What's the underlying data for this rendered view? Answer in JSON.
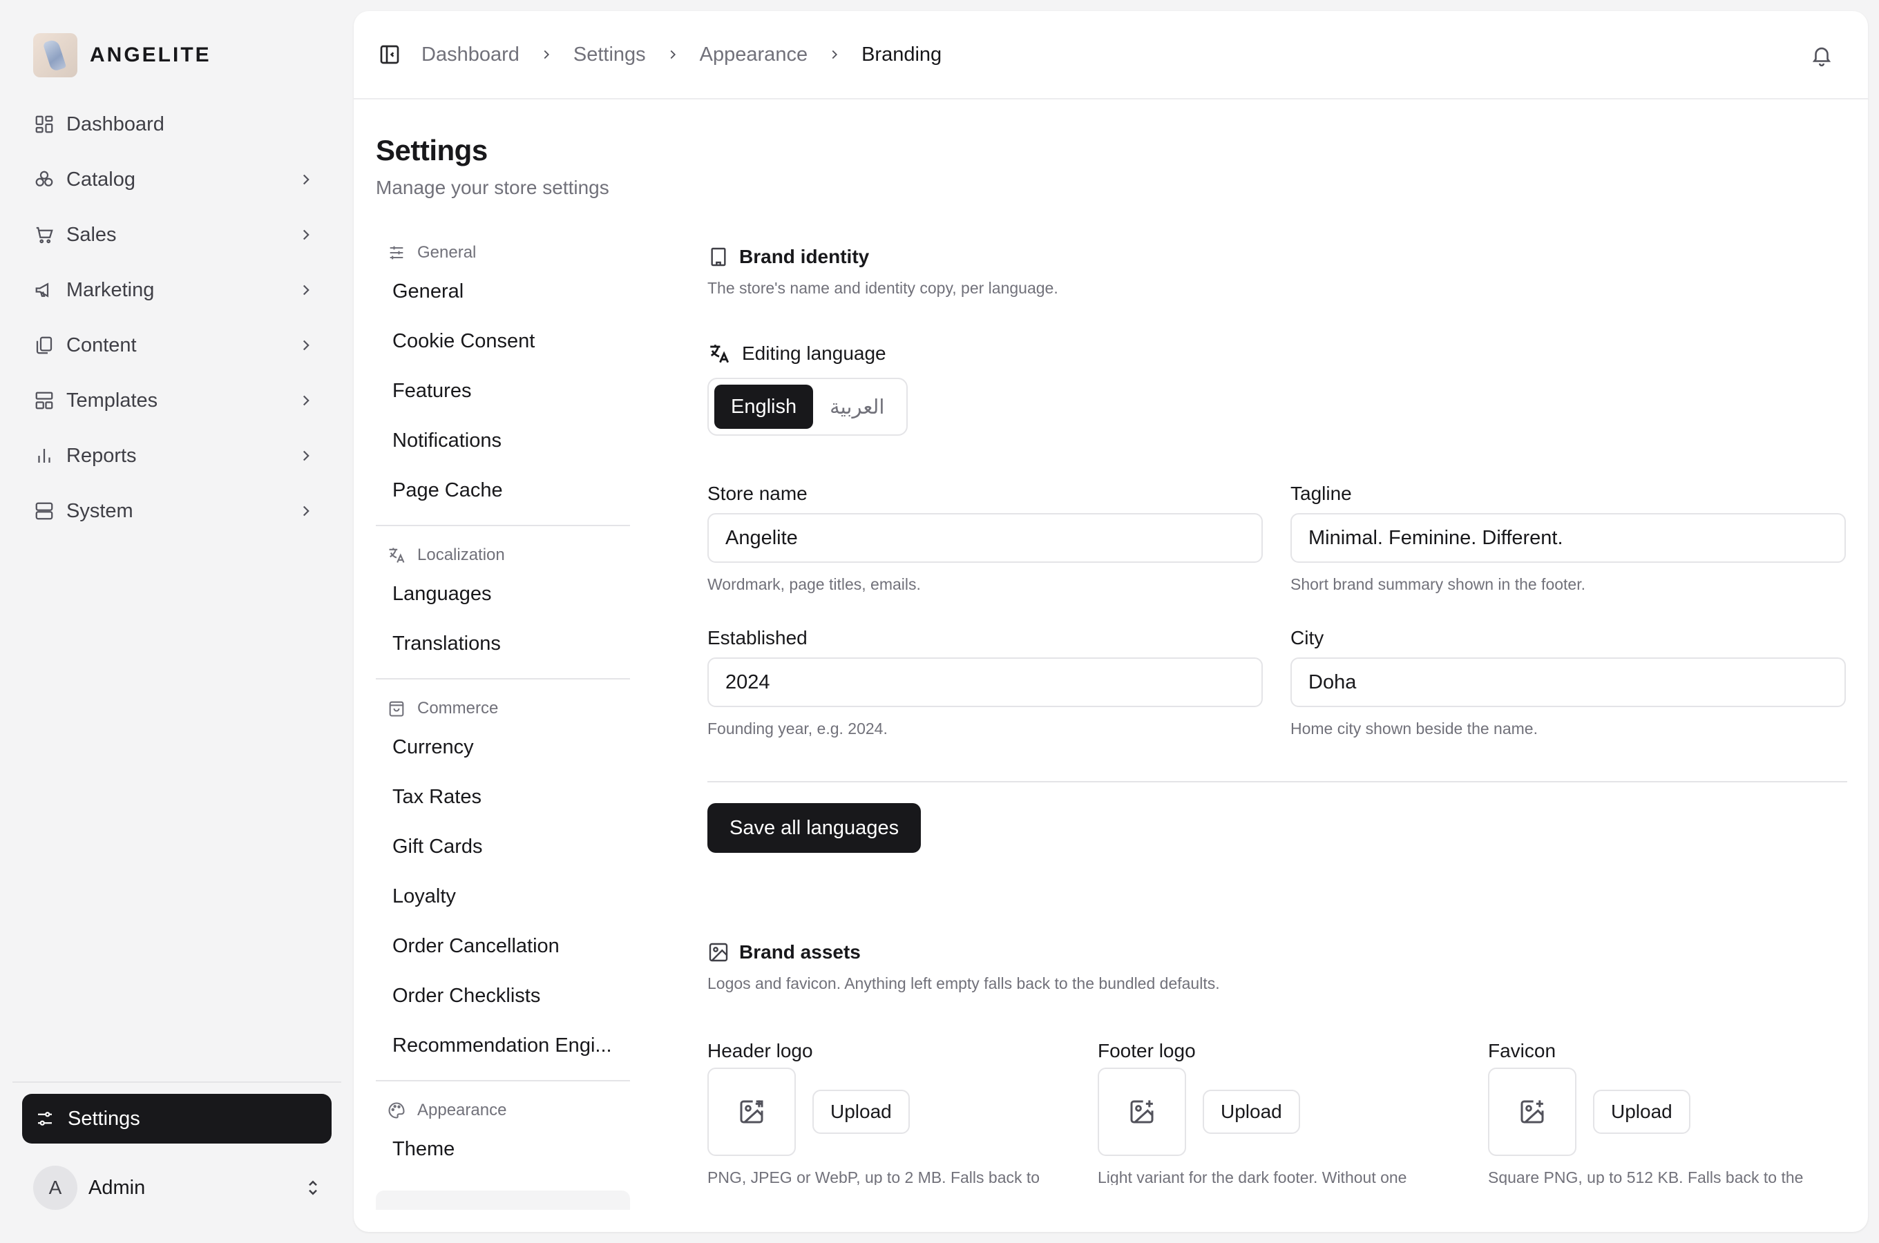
{
  "brand": {
    "name": "ANGELITE"
  },
  "sidebar": {
    "items": [
      {
        "label": "Dashboard",
        "icon": "dashboard-icon",
        "has_chevron": false
      },
      {
        "label": "Catalog",
        "icon": "catalog-icon",
        "has_chevron": true
      },
      {
        "label": "Sales",
        "icon": "cart-icon",
        "has_chevron": true
      },
      {
        "label": "Marketing",
        "icon": "megaphone-icon",
        "has_chevron": true
      },
      {
        "label": "Content",
        "icon": "copy-icon",
        "has_chevron": true
      },
      {
        "label": "Templates",
        "icon": "templates-icon",
        "has_chevron": true
      },
      {
        "label": "Reports",
        "icon": "bar-chart-icon",
        "has_chevron": true
      },
      {
        "label": "System",
        "icon": "server-icon",
        "has_chevron": true
      }
    ],
    "active_item": {
      "label": "Settings",
      "icon": "settings-sliders-icon"
    },
    "user": {
      "initial": "A",
      "name": "Admin"
    }
  },
  "topbar": {
    "breadcrumb": [
      "Dashboard",
      "Settings",
      "Appearance",
      "Branding"
    ]
  },
  "page": {
    "title": "Settings",
    "subtitle": "Manage your store settings"
  },
  "subnav": {
    "groups": [
      {
        "title": "General",
        "icon": "sliders-icon",
        "items": [
          "General",
          "Cookie Consent",
          "Features",
          "Notifications",
          "Page Cache"
        ]
      },
      {
        "title": "Localization",
        "icon": "translate-icon",
        "items": [
          "Languages",
          "Translations"
        ]
      },
      {
        "title": "Commerce",
        "icon": "bag-icon",
        "items": [
          "Currency",
          "Tax Rates",
          "Gift Cards",
          "Loyalty",
          "Order Cancellation",
          "Order Checklists",
          "Recommendation Engi..."
        ]
      },
      {
        "title": "Appearance",
        "icon": "palette-icon",
        "items": [
          "Theme"
        ]
      }
    ]
  },
  "brand_identity": {
    "title": "Brand identity",
    "description": "The store's name and identity copy, per language.",
    "editing_language_label": "Editing language",
    "languages": [
      "English",
      "العربية"
    ],
    "active_language": "English",
    "fields": {
      "store_name": {
        "label": "Store name",
        "value": "Angelite",
        "help": "Wordmark, page titles, emails."
      },
      "tagline": {
        "label": "Tagline",
        "value": "Minimal. Feminine. Different.",
        "help": "Short brand summary shown in the footer."
      },
      "established": {
        "label": "Established",
        "value": "2024",
        "help": "Founding year, e.g. 2024."
      },
      "city": {
        "label": "City",
        "value": "Doha",
        "help": "Home city shown beside the name."
      }
    },
    "save_label": "Save all languages"
  },
  "brand_assets": {
    "title": "Brand assets",
    "description": "Logos and favicon. Anything left empty falls back to the bundled defaults.",
    "assets": [
      {
        "label": "Header logo",
        "button": "Upload",
        "help": "PNG, JPEG or WebP, up to 2 MB. Falls back to"
      },
      {
        "label": "Footer logo",
        "button": "Upload",
        "help": "Light variant for the dark footer. Without one"
      },
      {
        "label": "Favicon",
        "button": "Upload",
        "help": "Square PNG, up to 512 KB. Falls back to the"
      }
    ]
  }
}
